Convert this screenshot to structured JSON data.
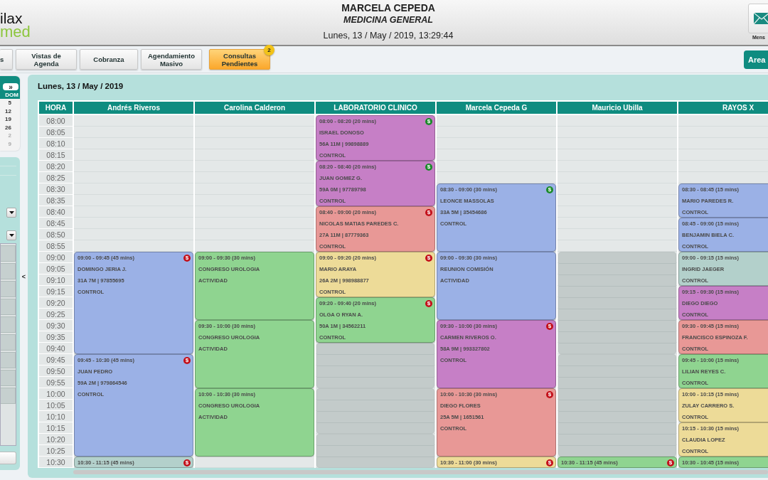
{
  "header": {
    "logo": {
      "top": "ilax",
      "bottom": "med"
    },
    "doctor": "MARCELA CEPEDA",
    "specialty": "MEDICINA GENERAL",
    "datetime": "Lunes, 13 / May / 2019, 13:29:44",
    "mail_label": "Mens"
  },
  "nav": {
    "tabs": [
      {
        "label": "s",
        "selected": false
      },
      {
        "label": "Vistas de Agenda",
        "selected": false
      },
      {
        "label": "Cobranza",
        "selected": false
      },
      {
        "label": "Agendamiento Masivo",
        "selected": false
      },
      {
        "label": "Consultas Pendientes",
        "selected": true,
        "badge": "2"
      }
    ],
    "area_button": "Area"
  },
  "mini_calendar": {
    "next": "»",
    "day_header": "DOM",
    "days": [
      {
        "label": "5",
        "other_month": false
      },
      {
        "label": "12",
        "other_month": false
      },
      {
        "label": "19",
        "other_month": false
      },
      {
        "label": "26",
        "other_month": false
      },
      {
        "label": "2",
        "other_month": true
      },
      {
        "label": "9",
        "other_month": true
      }
    ]
  },
  "agenda": {
    "title": "Lunes, 13 / May / 2019",
    "collapse": "<",
    "hour_header": "HORA",
    "hours": [
      "08:00",
      "08:05",
      "08:10",
      "08:15",
      "08:20",
      "08:25",
      "08:30",
      "08:35",
      "08:40",
      "08:45",
      "08:50",
      "08:55",
      "09:00",
      "09:05",
      "09:10",
      "09:15",
      "09:20",
      "09:25",
      "09:30",
      "09:35",
      "09:40",
      "09:45",
      "09:50",
      "09:55",
      "10:00",
      "10:05",
      "10:10",
      "10:15",
      "10:20",
      "10:25",
      "10:30"
    ],
    "columns": [
      {
        "name": "Andrés Riveros",
        "cells": [
          {
            "kind": "free"
          },
          {
            "kind": "free"
          },
          {
            "kind": "free"
          },
          {
            "kind": "free"
          },
          {
            "kind": "free"
          },
          {
            "kind": "free"
          },
          {
            "kind": "free"
          },
          {
            "kind": "free"
          },
          {
            "kind": "free"
          },
          {
            "kind": "free"
          },
          {
            "kind": "free"
          },
          {
            "kind": "free"
          },
          {
            "kind": "appointment",
            "color": "#9bb1e6",
            "time": "09:00 - 09:45 (45 mins)",
            "name": "DOMINGO JERIA J.",
            "details": "31A 7M | 97855695",
            "type": "CONTROL",
            "badge": "$",
            "paid": false
          },
          {
            "kind": "continued"
          },
          {
            "kind": "continued"
          },
          {
            "kind": "continued"
          },
          {
            "kind": "continued"
          },
          {
            "kind": "continued"
          },
          {
            "kind": "continued"
          },
          {
            "kind": "continued"
          },
          {
            "kind": "continued"
          },
          {
            "kind": "appointment",
            "color": "#9bb1e6",
            "time": "09:45 - 10:30 (45 mins)",
            "name": "JUAN PEDRO",
            "details": "59A 2M | 979864546",
            "type": "CONTROL",
            "badge": "$",
            "paid": false
          },
          {
            "kind": "continued"
          },
          {
            "kind": "continued"
          },
          {
            "kind": "continued"
          },
          {
            "kind": "continued"
          },
          {
            "kind": "continued"
          },
          {
            "kind": "continued"
          },
          {
            "kind": "continued"
          },
          {
            "kind": "continued"
          },
          {
            "kind": "appointment",
            "color": "#b3d0cb",
            "time": "10:30 - 11:15 (45 mins)",
            "badge": "$",
            "paid": false
          }
        ]
      },
      {
        "name": "Carolina Calderon",
        "cells": [
          {
            "kind": "free"
          },
          {
            "kind": "free"
          },
          {
            "kind": "free"
          },
          {
            "kind": "free"
          },
          {
            "kind": "free"
          },
          {
            "kind": "free"
          },
          {
            "kind": "free"
          },
          {
            "kind": "free"
          },
          {
            "kind": "free"
          },
          {
            "kind": "free"
          },
          {
            "kind": "free"
          },
          {
            "kind": "free"
          },
          {
            "kind": "appointment",
            "color": "#8fd490",
            "time": "09:00 - 09:30 (30 mins)",
            "name": "CONGRESO UROLOGIA",
            "type": "ACTIVIDAD"
          },
          {
            "kind": "continued"
          },
          {
            "kind": "continued"
          },
          {
            "kind": "continued"
          },
          {
            "kind": "continued"
          },
          {
            "kind": "continued"
          },
          {
            "kind": "appointment",
            "color": "#8fd490",
            "time": "09:30 - 10:00 (30 mins)",
            "name": "CONGRESO UROLOGIA",
            "type": "ACTIVIDAD"
          },
          {
            "kind": "continued"
          },
          {
            "kind": "continued"
          },
          {
            "kind": "continued"
          },
          {
            "kind": "continued"
          },
          {
            "kind": "continued"
          },
          {
            "kind": "appointment",
            "color": "#8fd490",
            "time": "10:00 - 10:30 (30 mins)",
            "name": "CONGRESO UROLOGIA",
            "type": "ACTIVIDAD"
          },
          {
            "kind": "continued"
          },
          {
            "kind": "continued"
          },
          {
            "kind": "continued"
          },
          {
            "kind": "continued"
          },
          {
            "kind": "continued"
          },
          {
            "kind": "free"
          }
        ]
      },
      {
        "name": "LABORATORIO CLINICO",
        "cells": [
          {
            "kind": "appointment",
            "color": "#c67fc6",
            "time": "08:00 - 08:20 (20 mins)",
            "name": "ISRAEL DONOSO",
            "details": "56A 11M | 99898889",
            "type": "CONTROL",
            "badge": "$",
            "paid": true
          },
          {
            "kind": "continued"
          },
          {
            "kind": "continued"
          },
          {
            "kind": "continued"
          },
          {
            "kind": "appointment",
            "color": "#c67fc6",
            "time": "08:20 - 08:40 (20 mins)",
            "name": "JUAN GOMEZ G.",
            "details": "59A 0M | 97789798",
            "type": "CONTROL",
            "badge": "$",
            "paid": true
          },
          {
            "kind": "continued"
          },
          {
            "kind": "continued"
          },
          {
            "kind": "continued"
          },
          {
            "kind": "appointment",
            "color": "#e89896",
            "time": "08:40 - 09:00 (20 mins)",
            "name": "NICOLAS MATIAS PAREDES C.",
            "details": "27A 11M | 87779363",
            "type": "CONTROL",
            "badge": "$",
            "paid": false
          },
          {
            "kind": "continued"
          },
          {
            "kind": "continued"
          },
          {
            "kind": "continued"
          },
          {
            "kind": "appointment",
            "color": "#eddb98",
            "time": "09:00 - 09:20 (20 mins)",
            "name": "MARIO ARAYA",
            "details": "26A 2M | 998988877",
            "type": "CONTROL",
            "badge": "$",
            "paid": false
          },
          {
            "kind": "continued"
          },
          {
            "kind": "continued"
          },
          {
            "kind": "continued"
          },
          {
            "kind": "appointment",
            "color": "#8fd490",
            "time": "09:20 - 09:40 (20 mins)",
            "name": "OLGA O RYAN A.",
            "details": "50A 1M | 34562211",
            "type": "CONTROL",
            "badge": "$",
            "paid": false
          },
          {
            "kind": "continued"
          },
          {
            "kind": "continued"
          },
          {
            "kind": "continued"
          },
          {
            "kind": "blocked"
          },
          {
            "kind": "continued"
          },
          {
            "kind": "continued"
          },
          {
            "kind": "continued"
          },
          {
            "kind": "blocked"
          },
          {
            "kind": "continued"
          },
          {
            "kind": "continued"
          },
          {
            "kind": "continued"
          },
          {
            "kind": "blocked"
          },
          {
            "kind": "continued"
          },
          {
            "kind": "continued"
          }
        ]
      },
      {
        "name": "Marcela Cepeda G",
        "cells": [
          {
            "kind": "free"
          },
          {
            "kind": "free"
          },
          {
            "kind": "free"
          },
          {
            "kind": "free"
          },
          {
            "kind": "free"
          },
          {
            "kind": "free"
          },
          {
            "kind": "appointment",
            "color": "#9bb1e6",
            "time": "08:30 - 09:00 (30 mins)",
            "name": "LEONCE MASSOLAS",
            "details": "33A 5M | 35454686",
            "type": "CONTROL",
            "badge": "$",
            "paid": true
          },
          {
            "kind": "continued"
          },
          {
            "kind": "continued"
          },
          {
            "kind": "continued"
          },
          {
            "kind": "continued"
          },
          {
            "kind": "continued"
          },
          {
            "kind": "appointment",
            "color": "#9bb1e6",
            "time": "09:00 - 09:30 (30 mins)",
            "name": "REUNION COMISIÓN",
            "type": "ACTIVIDAD"
          },
          {
            "kind": "continued"
          },
          {
            "kind": "continued"
          },
          {
            "kind": "continued"
          },
          {
            "kind": "continued"
          },
          {
            "kind": "continued"
          },
          {
            "kind": "appointment",
            "color": "#c67fc6",
            "time": "09:30 - 10:00 (30 mins)",
            "name": "CARMEN RIVEROS O.",
            "details": "58A 9M | 993327802",
            "type": "CONTROL",
            "badge": "$",
            "paid": false
          },
          {
            "kind": "continued"
          },
          {
            "kind": "continued"
          },
          {
            "kind": "continued"
          },
          {
            "kind": "continued"
          },
          {
            "kind": "continued"
          },
          {
            "kind": "appointment",
            "color": "#e89896",
            "time": "10:00 - 10:30 (30 mins)",
            "name": "DIEGO FLORES",
            "details": "25A 5M | 1651561",
            "type": "CONTROL",
            "badge": "$",
            "paid": false
          },
          {
            "kind": "continued"
          },
          {
            "kind": "continued"
          },
          {
            "kind": "continued"
          },
          {
            "kind": "continued"
          },
          {
            "kind": "continued"
          },
          {
            "kind": "appointment",
            "color": "#eddb98",
            "time": "10:30 - 11:00 (30 mins)",
            "badge": "$",
            "paid": false
          }
        ]
      },
      {
        "name": "Mauricio Ubilla",
        "cells": [
          {
            "kind": "free"
          },
          {
            "kind": "free"
          },
          {
            "kind": "free"
          },
          {
            "kind": "free"
          },
          {
            "kind": "free"
          },
          {
            "kind": "free"
          },
          {
            "kind": "free"
          },
          {
            "kind": "free"
          },
          {
            "kind": "free"
          },
          {
            "kind": "free"
          },
          {
            "kind": "free"
          },
          {
            "kind": "free"
          },
          {
            "kind": "blocked"
          },
          {
            "kind": "continued"
          },
          {
            "kind": "continued"
          },
          {
            "kind": "continued"
          },
          {
            "kind": "continued"
          },
          {
            "kind": "continued"
          },
          {
            "kind": "continued"
          },
          {
            "kind": "continued"
          },
          {
            "kind": "continued"
          },
          {
            "kind": "blocked"
          },
          {
            "kind": "continued"
          },
          {
            "kind": "continued"
          },
          {
            "kind": "continued"
          },
          {
            "kind": "continued"
          },
          {
            "kind": "continued"
          },
          {
            "kind": "continued"
          },
          {
            "kind": "continued"
          },
          {
            "kind": "continued"
          },
          {
            "kind": "appointment",
            "color": "#8fd490",
            "time": "10:30 - 11:15 (45 mins)",
            "badge": "$",
            "paid": false
          }
        ]
      },
      {
        "name": "RAYOS X",
        "cells": [
          {
            "kind": "free"
          },
          {
            "kind": "free"
          },
          {
            "kind": "free"
          },
          {
            "kind": "free"
          },
          {
            "kind": "free"
          },
          {
            "kind": "free"
          },
          {
            "kind": "appointment",
            "color": "#9bb1e6",
            "time": "08:30 - 08:45 (15 mins)",
            "name": "MARIO PAREDES R.",
            "type": "CONTROL"
          },
          {
            "kind": "continued"
          },
          {
            "kind": "continued"
          },
          {
            "kind": "appointment",
            "color": "#9bb1e6",
            "time": "08:45 - 09:00 (15 mins)",
            "name": "BENJAMIN BIELA C.",
            "type": "CONTROL"
          },
          {
            "kind": "continued"
          },
          {
            "kind": "continued"
          },
          {
            "kind": "appointment",
            "color": "#b3d0cb",
            "time": "09:00 - 09:15 (15 mins)",
            "name": "INGRID JAEGER",
            "type": "CONTROL"
          },
          {
            "kind": "continued"
          },
          {
            "kind": "continued"
          },
          {
            "kind": "appointment",
            "color": "#c67fc6",
            "time": "09:15 - 09:30 (15 mins)",
            "name": "DIEGO DIEGO",
            "type": "CONTROL"
          },
          {
            "kind": "continued"
          },
          {
            "kind": "continued"
          },
          {
            "kind": "appointment",
            "color": "#e89896",
            "time": "09:30 - 09:45 (15 mins)",
            "name": "FRANCISCO ESPINOZA F.",
            "type": "CONTROL"
          },
          {
            "kind": "continued"
          },
          {
            "kind": "continued"
          },
          {
            "kind": "appointment",
            "color": "#8fd490",
            "time": "09:45 - 10:00 (15 mins)",
            "name": "LILIAN REYES C.",
            "type": "CONTROL"
          },
          {
            "kind": "continued"
          },
          {
            "kind": "continued"
          },
          {
            "kind": "appointment",
            "color": "#eddb98",
            "time": "10:00 - 10:15 (15 mins)",
            "name": "ZULAY CARRERO S.",
            "type": "CONTROL"
          },
          {
            "kind": "continued"
          },
          {
            "kind": "continued"
          },
          {
            "kind": "appointment",
            "color": "#eddb98",
            "time": "10:15 - 10:30 (15 mins)",
            "name": "CLAUDIA LOPEZ",
            "type": "CONTROL"
          },
          {
            "kind": "continued"
          },
          {
            "kind": "continued"
          },
          {
            "kind": "appointment",
            "color": "#8fd490",
            "time": "10:30 - 10:45 (15 mins)"
          }
        ]
      }
    ]
  }
}
